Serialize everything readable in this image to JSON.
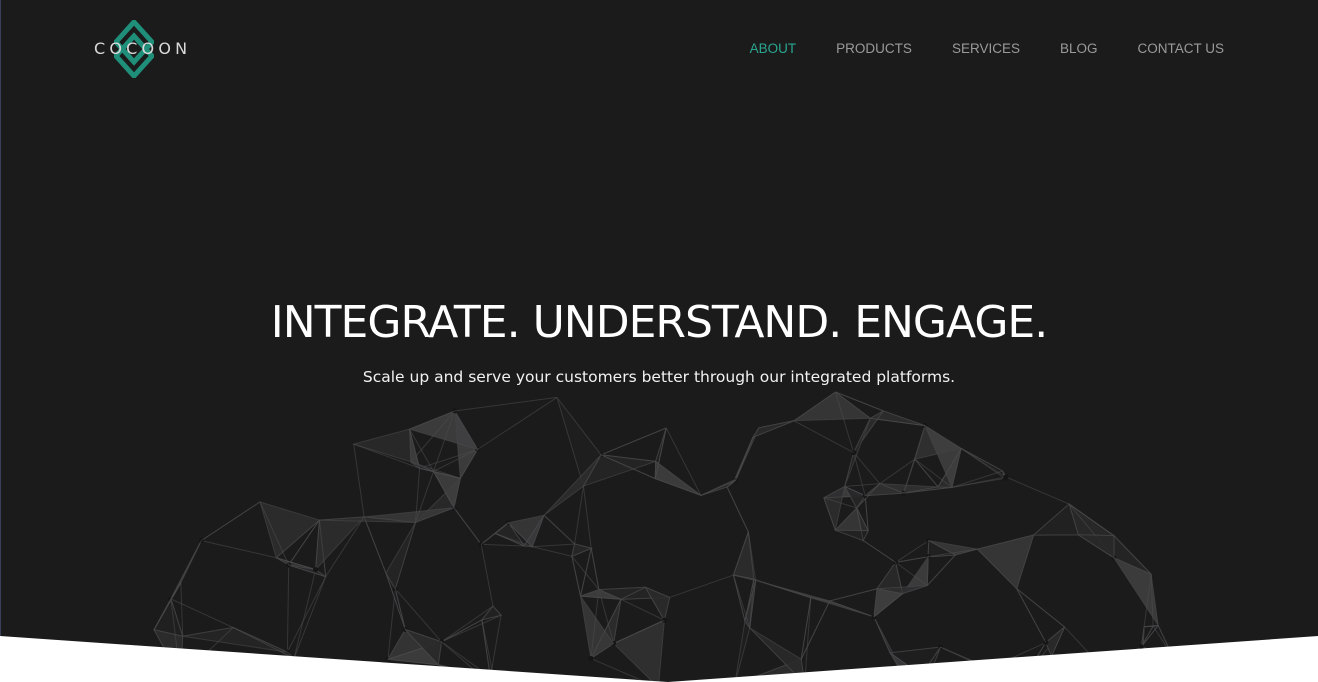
{
  "brand": {
    "name": "COCOON",
    "accent_color": "#2aa68f"
  },
  "nav": {
    "items": [
      {
        "label": "ABOUT",
        "active": true
      },
      {
        "label": "PRODUCTS",
        "active": false
      },
      {
        "label": "SERVICES",
        "active": false
      },
      {
        "label": "BLOG",
        "active": false
      },
      {
        "label": "CONTACT US",
        "active": false
      }
    ]
  },
  "hero": {
    "headline": "INTEGRATE. UNDERSTAND. ENGAGE.",
    "subheadline": "Scale up and serve your customers better through our integrated platforms.",
    "background_color": "#1b1b1c"
  }
}
